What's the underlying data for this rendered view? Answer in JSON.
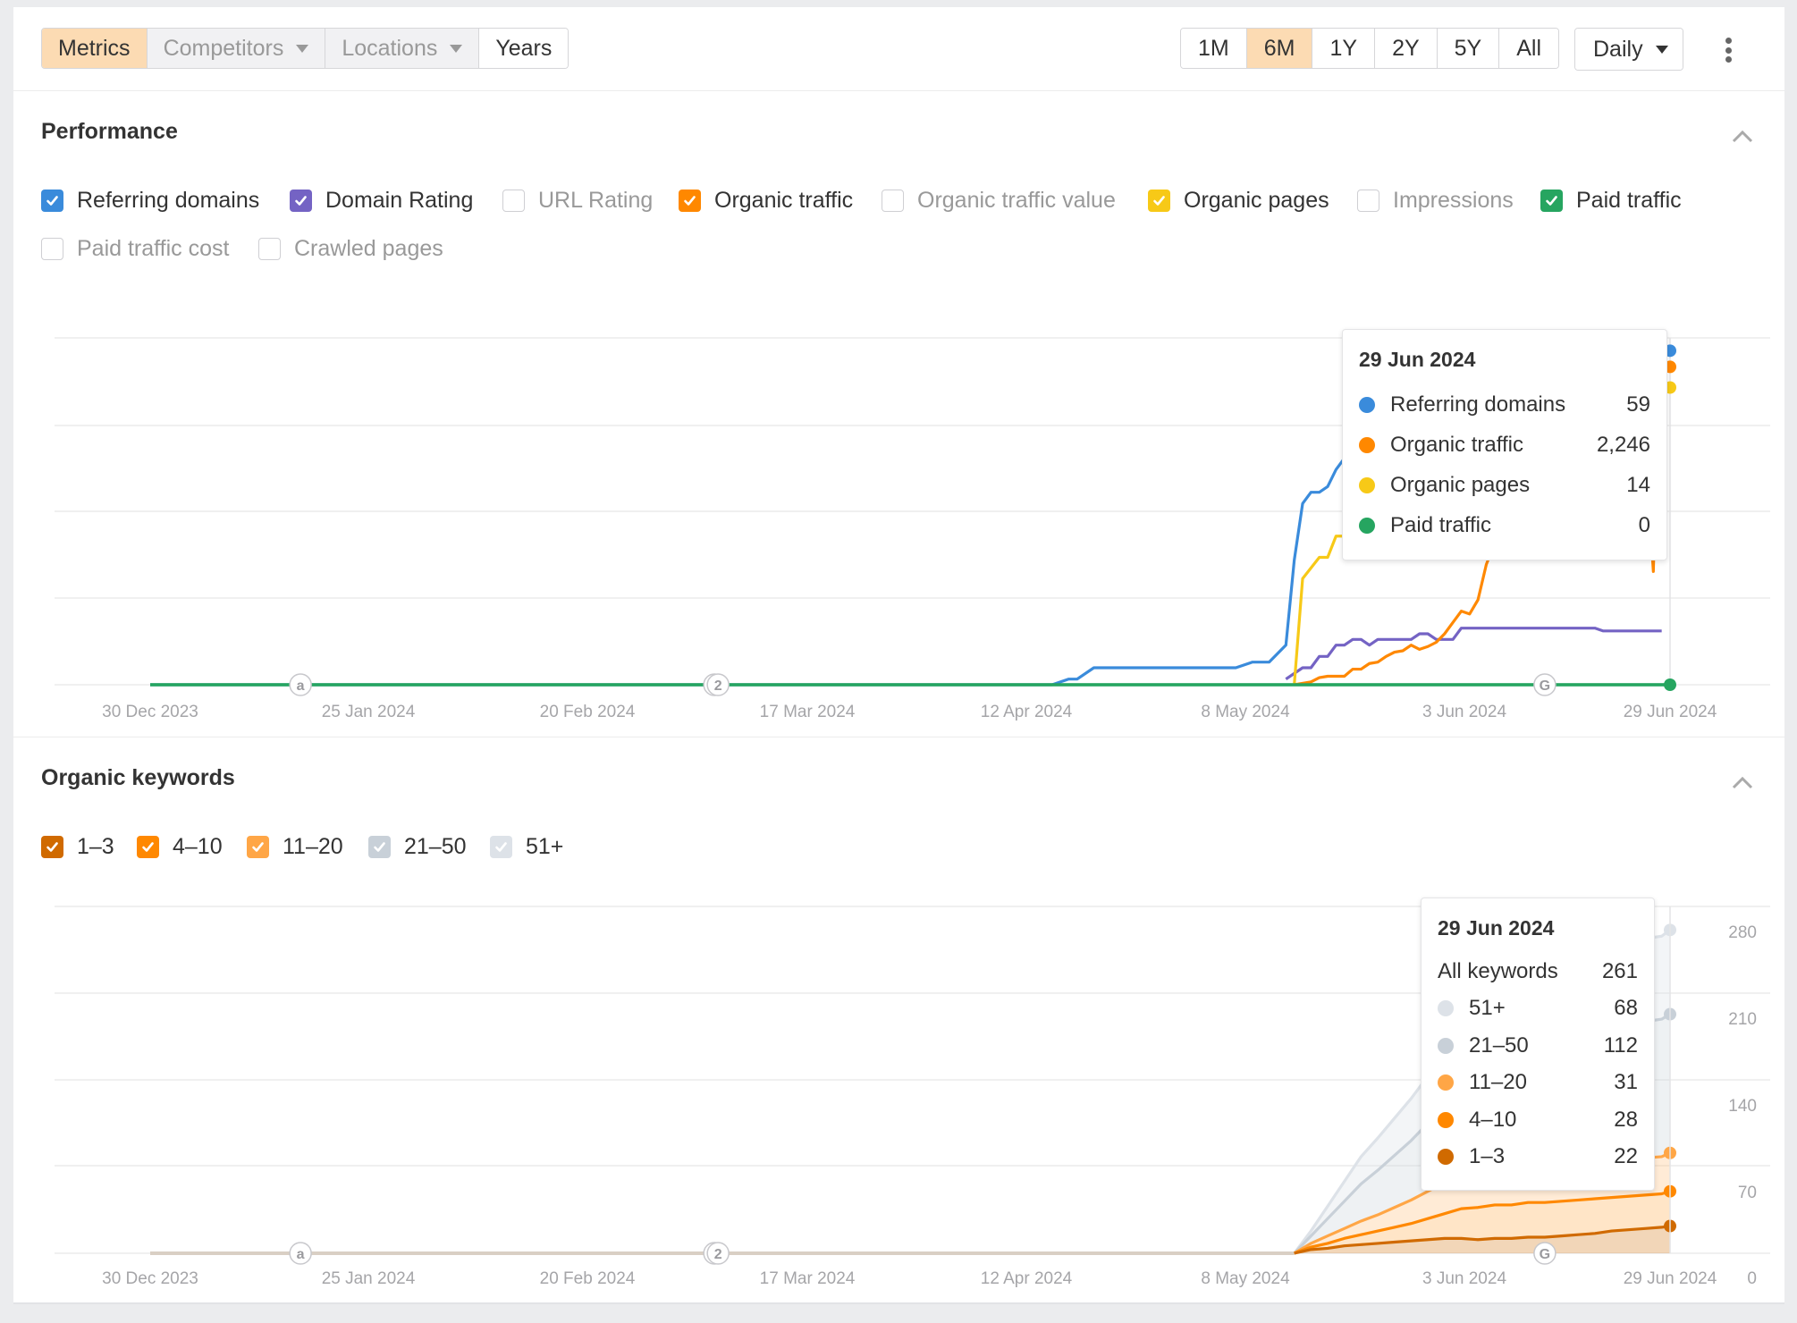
{
  "toolbar": {
    "view_tabs": [
      {
        "label": "Metrics",
        "state": "active",
        "dropdown": false
      },
      {
        "label": "Competitors",
        "state": "disabled",
        "dropdown": true
      },
      {
        "label": "Locations",
        "state": "disabled",
        "dropdown": true
      },
      {
        "label": "Years",
        "state": "normal",
        "dropdown": false
      }
    ],
    "ranges": [
      {
        "label": "1M",
        "active": false
      },
      {
        "label": "6M",
        "active": true
      },
      {
        "label": "1Y",
        "active": false
      },
      {
        "label": "2Y",
        "active": false
      },
      {
        "label": "5Y",
        "active": false
      },
      {
        "label": "All",
        "active": false
      }
    ],
    "granularity": "Daily",
    "more_icon": "kebab-vertical-icon"
  },
  "performance": {
    "title": "Performance",
    "collapse_icon": "chevron-up-icon",
    "metrics": [
      {
        "label": "Referring domains",
        "checked": true,
        "color": "#3a8bdb"
      },
      {
        "label": "Domain Rating",
        "checked": true,
        "color": "#7463c4"
      },
      {
        "label": "URL Rating",
        "checked": false,
        "color": null
      },
      {
        "label": "Organic traffic",
        "checked": true,
        "color": "#ff8800"
      },
      {
        "label": "Organic traffic value",
        "checked": false,
        "color": null
      },
      {
        "label": "Organic pages",
        "checked": true,
        "color": "#f7c917"
      },
      {
        "label": "Impressions",
        "checked": false,
        "color": null
      },
      {
        "label": "Paid traffic",
        "checked": true,
        "color": "#26a560"
      },
      {
        "label": "Paid traffic cost",
        "checked": false,
        "color": null
      },
      {
        "label": "Crawled pages",
        "checked": false,
        "color": null
      }
    ],
    "tooltip": {
      "date": "29 Jun 2024",
      "rows": [
        {
          "name": "Referring domains",
          "value": "59",
          "color": "#3a8bdb"
        },
        {
          "name": "Organic traffic",
          "value": "2,246",
          "color": "#ff8800"
        },
        {
          "name": "Organic pages",
          "value": "14",
          "color": "#f7c917"
        },
        {
          "name": "Paid traffic",
          "value": "0",
          "color": "#26a560"
        }
      ]
    }
  },
  "keywords": {
    "title": "Organic keywords",
    "collapse_icon": "chevron-up-icon",
    "positions": [
      {
        "label": "1–3",
        "checked": true,
        "color": "#d06a00"
      },
      {
        "label": "4–10",
        "checked": true,
        "color": "#ff8800"
      },
      {
        "label": "11–20",
        "checked": true,
        "color": "#ffa646"
      },
      {
        "label": "21–50",
        "checked": true,
        "color": "#c8d0d8"
      },
      {
        "label": "51+",
        "checked": true,
        "color": "#dde2e8"
      }
    ],
    "tooltip": {
      "date": "29 Jun 2024",
      "total_label": "All keywords",
      "total_value": "261",
      "rows": [
        {
          "name": "51+",
          "value": "68",
          "color": "#dde2e8"
        },
        {
          "name": "21–50",
          "value": "112",
          "color": "#c8d0d8"
        },
        {
          "name": "11–20",
          "value": "31",
          "color": "#ffa646"
        },
        {
          "name": "4–10",
          "value": "28",
          "color": "#ff8800"
        },
        {
          "name": "1–3",
          "value": "22",
          "color": "#d06a00"
        }
      ]
    }
  },
  "chart_data": [
    {
      "type": "line",
      "title": "Performance",
      "x_tick_labels": [
        "30 Dec 2023",
        "25 Jan 2024",
        "20 Feb 2024",
        "17 Mar 2024",
        "12 Apr 2024",
        "8 May 2024",
        "3 Jun 2024",
        "29 Jun 2024"
      ],
      "x_range_days": [
        0,
        182
      ],
      "y_axis": "normalized per series (no tick labels shown)",
      "grid": true,
      "annotations": [
        {
          "day": 18,
          "label": "a"
        },
        {
          "day": 68,
          "label": "2"
        },
        {
          "day": 167,
          "label": "G"
        }
      ],
      "series": [
        {
          "name": "Referring domains",
          "color": "#3a8bdb",
          "end_value": 59,
          "scale_max": 60,
          "points": [
            [
              0,
              0
            ],
            [
              108,
              0
            ],
            [
              110,
              1
            ],
            [
              111,
              1
            ],
            [
              113,
              3
            ],
            [
              130,
              3
            ],
            [
              132,
              4
            ],
            [
              134,
              4
            ],
            [
              136,
              7
            ],
            [
              137,
              22
            ],
            [
              138,
              32
            ],
            [
              139,
              34
            ],
            [
              140,
              34
            ],
            [
              141,
              35
            ],
            [
              142,
              38
            ],
            [
              143,
              40
            ],
            [
              144,
              41
            ],
            [
              151,
              41
            ],
            [
              153,
              41
            ],
            [
              154,
              59
            ],
            [
              182,
              59
            ]
          ]
        },
        {
          "name": "Domain Rating",
          "color": "#7463c4",
          "scale_max": 60,
          "points": [
            [
              136,
              1
            ],
            [
              138,
              3
            ],
            [
              139,
              3
            ],
            [
              140,
              5
            ],
            [
              141,
              5
            ],
            [
              142,
              7
            ],
            [
              143,
              7
            ],
            [
              144,
              8
            ],
            [
              145,
              8
            ],
            [
              146,
              7
            ],
            [
              147,
              8
            ],
            [
              151,
              8
            ],
            [
              152,
              9
            ],
            [
              153,
              9
            ],
            [
              154,
              8
            ],
            [
              156,
              8
            ],
            [
              157,
              10
            ],
            [
              173,
              10
            ],
            [
              174,
              9.5
            ],
            [
              181,
              9.5
            ]
          ]
        },
        {
          "name": "Organic traffic",
          "color": "#ff8800",
          "end_value": 2246,
          "scale_max": 2400,
          "points": [
            [
              137,
              0
            ],
            [
              139,
              20
            ],
            [
              140,
              50
            ],
            [
              141,
              60
            ],
            [
              143,
              60
            ],
            [
              144,
              110
            ],
            [
              145,
              110
            ],
            [
              146,
              150
            ],
            [
              147,
              160
            ],
            [
              148,
              200
            ],
            [
              149,
              230
            ],
            [
              150,
              240
            ],
            [
              151,
              280
            ],
            [
              152,
              250
            ],
            [
              153,
              270
            ],
            [
              154,
              300
            ],
            [
              155,
              360
            ],
            [
              156,
              440
            ],
            [
              157,
              520
            ],
            [
              158,
              500
            ],
            [
              159,
              600
            ],
            [
              160,
              850
            ],
            [
              161,
              1000
            ],
            [
              162,
              1200
            ],
            [
              163,
              1350
            ],
            [
              164,
              1500
            ],
            [
              178,
              1560
            ],
            [
              179,
              1700
            ],
            [
              180,
              800
            ],
            [
              180.5,
              1900
            ],
            [
              181,
              2200
            ],
            [
              182,
              2246
            ]
          ]
        },
        {
          "name": "Organic pages",
          "color": "#f7c917",
          "end_value": 14,
          "scale_max": 16,
          "points": [
            [
              137,
              0
            ],
            [
              138,
              5
            ],
            [
              139,
              5.5
            ],
            [
              140,
              6
            ],
            [
              141,
              6
            ],
            [
              142,
              7
            ],
            [
              145,
              7
            ],
            [
              146,
              8
            ],
            [
              148,
              9
            ],
            [
              150,
              10
            ],
            [
              178,
              11
            ],
            [
              180,
              12.5
            ],
            [
              181,
              13.5
            ],
            [
              182,
              14
            ]
          ]
        },
        {
          "name": "Paid traffic",
          "color": "#26a560",
          "end_value": 0,
          "scale_max": 60,
          "points": [
            [
              0,
              0
            ],
            [
              182,
              0
            ]
          ]
        }
      ]
    },
    {
      "type": "area",
      "title": "Organic keywords",
      "stacked": true,
      "x_tick_labels": [
        "30 Dec 2023",
        "25 Jan 2024",
        "20 Feb 2024",
        "17 Mar 2024",
        "12 Apr 2024",
        "8 May 2024",
        "3 Jun 2024",
        "29 Jun 2024"
      ],
      "x_range_days": [
        0,
        182
      ],
      "y_tick_labels": [
        "0",
        "70",
        "140",
        "210",
        "280"
      ],
      "ylim": [
        0,
        280
      ],
      "grid": true,
      "annotations": [
        {
          "day": 18,
          "label": "a"
        },
        {
          "day": 68,
          "label": "2"
        },
        {
          "day": 167,
          "label": "G"
        }
      ],
      "x_days": [
        0,
        137,
        139,
        141,
        143,
        145,
        147,
        149,
        151,
        153,
        155,
        157,
        159,
        161,
        163,
        165,
        167,
        169,
        171,
        173,
        175,
        177,
        179,
        181,
        182
      ],
      "series": [
        {
          "name": "1–3",
          "color": "#d06a00",
          "values": [
            0,
            0,
            3,
            4,
            6,
            7,
            8,
            9,
            10,
            11,
            12,
            12,
            11,
            12,
            12,
            13,
            13,
            14,
            15,
            16,
            18,
            19,
            20,
            21,
            22
          ]
        },
        {
          "name": "4–10",
          "color": "#ff8800",
          "values": [
            0,
            0,
            2,
            4,
            6,
            8,
            10,
            12,
            14,
            17,
            20,
            24,
            26,
            27,
            27,
            28,
            28,
            28,
            28,
            28,
            27,
            27,
            27,
            27,
            28
          ]
        },
        {
          "name": "11–20",
          "color": "#ffa646",
          "values": [
            0,
            0,
            3,
            6,
            8,
            11,
            13,
            16,
            19,
            22,
            25,
            27,
            28,
            29,
            30,
            30,
            30,
            30,
            30,
            30,
            30,
            30,
            30,
            30,
            31
          ]
        },
        {
          "name": "21–50",
          "color": "#c8d0d8",
          "values": [
            0,
            0,
            6,
            14,
            22,
            30,
            36,
            42,
            48,
            55,
            62,
            68,
            74,
            80,
            86,
            90,
            94,
            98,
            101,
            104,
            106,
            108,
            110,
            111,
            112
          ]
        },
        {
          "name": "51+",
          "color": "#dde2e8",
          "values": [
            0,
            0,
            4,
            10,
            16,
            22,
            26,
            30,
            34,
            38,
            42,
            46,
            50,
            53,
            56,
            58,
            60,
            62,
            63,
            64,
            65,
            66,
            67,
            67,
            68
          ]
        }
      ]
    }
  ]
}
